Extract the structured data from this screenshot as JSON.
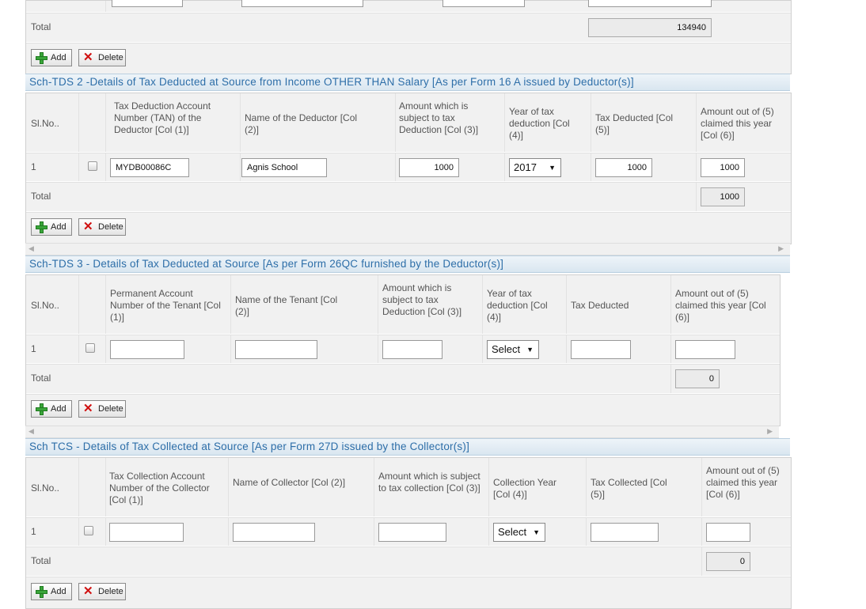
{
  "add_label": "Add",
  "delete_label": "Delete",
  "total_label": "Total",
  "top_section": {
    "total_value": "134940"
  },
  "tds2": {
    "title": "Sch-TDS 2 -Details of Tax Deducted at Source from Income OTHER THAN Salary [As per Form 16 A issued by Deductor(s)]",
    "headers": [
      "Sl.No..",
      "Tax Deduction Account Number (TAN) of the Deductor [Col (1)]",
      "Name of the Deductor [Col (2)]",
      "Amount which is subject to tax Deduction [Col (3)]",
      "Year of tax deduction [Col (4)]",
      "Tax Deducted [Col (5)]",
      "Amount out of (5) claimed this year [Col (6)]"
    ],
    "row": {
      "slno": "1",
      "tan": "MYDB00086C",
      "name": "Agnis School",
      "amount": "1000",
      "year": "2017",
      "tax": "1000",
      "claimed": "1000"
    },
    "total_value": "1000"
  },
  "tds3": {
    "title": "Sch-TDS 3 - Details of Tax Deducted at Source [As per Form 26QC furnished by the Deductor(s)]",
    "headers": [
      "Sl.No..",
      "Permanent Account Number of the Tenant [Col (1)]",
      "Name of the Tenant [Col (2)]",
      "Amount which is subject to tax Deduction [Col (3)]",
      "Year of tax deduction [Col (4)]",
      "Tax Deducted",
      "Amount out of (5) claimed this year [Col (6)]"
    ],
    "row": {
      "slno": "1",
      "year": "Select"
    },
    "total_value": "0"
  },
  "tcs": {
    "title": "Sch TCS - Details of Tax Collected at Source [As per Form 27D issued by the Collector(s)]",
    "headers": [
      "Sl.No..",
      "Tax Collection Account Number of the Collector [Col (1)]",
      "Name of Collector [Col (2)]",
      "Amount which is subject to tax collection [Col (3)]",
      "Collection Year [Col (4)]",
      "Tax Collected [Col (5)]",
      "Amount out of (5) claimed this year [Col (6)]"
    ],
    "row": {
      "slno": "1",
      "year": "Select"
    },
    "total_value": "0"
  },
  "icons": [
    "plus-icon",
    "delete-x-icon",
    "dropdown-arrow-icon",
    "scroll-left-icon",
    "scroll-right-icon"
  ],
  "colors": {
    "section_title": "#2d6ea8",
    "add_icon": "#3aa53a",
    "delete_icon": "#d01010"
  }
}
